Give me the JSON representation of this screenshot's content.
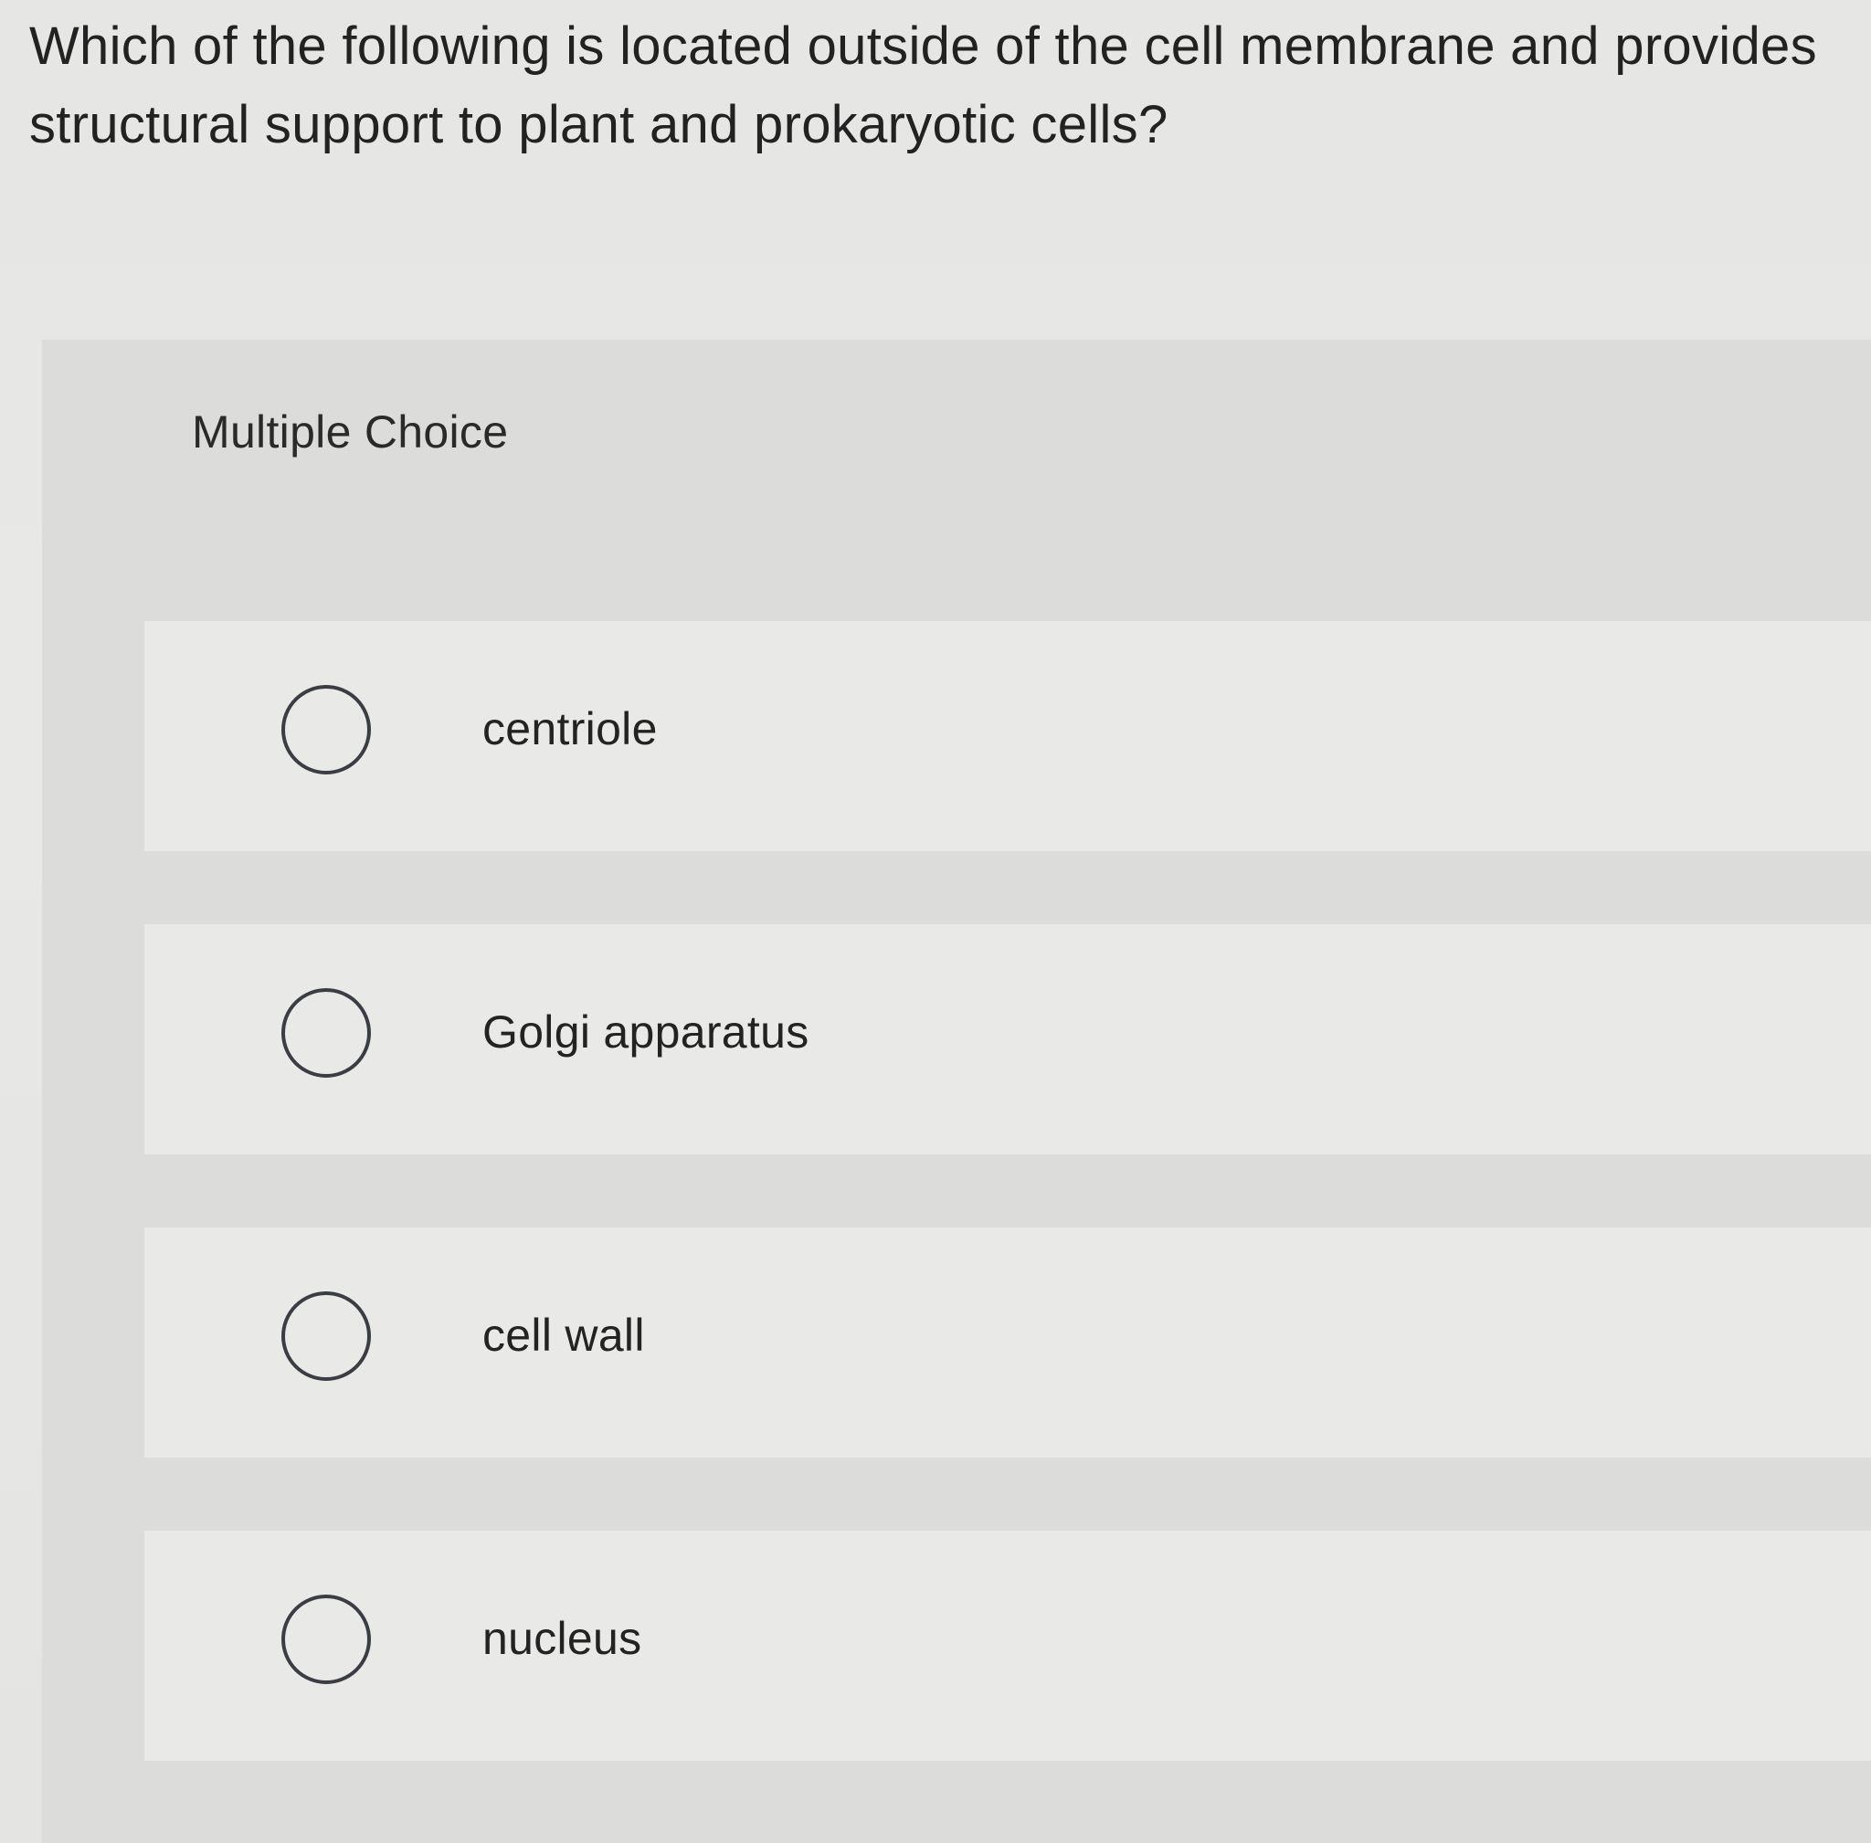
{
  "question": {
    "text": "Which of the following is located outside of the cell membrane and provides structural support to plant and prokaryotic cells?"
  },
  "panel": {
    "label": "Multiple Choice"
  },
  "options": [
    {
      "label": "centriole",
      "selected": false
    },
    {
      "label": "Golgi apparatus",
      "selected": false
    },
    {
      "label": "cell wall",
      "selected": false
    },
    {
      "label": "nucleus",
      "selected": false
    }
  ]
}
